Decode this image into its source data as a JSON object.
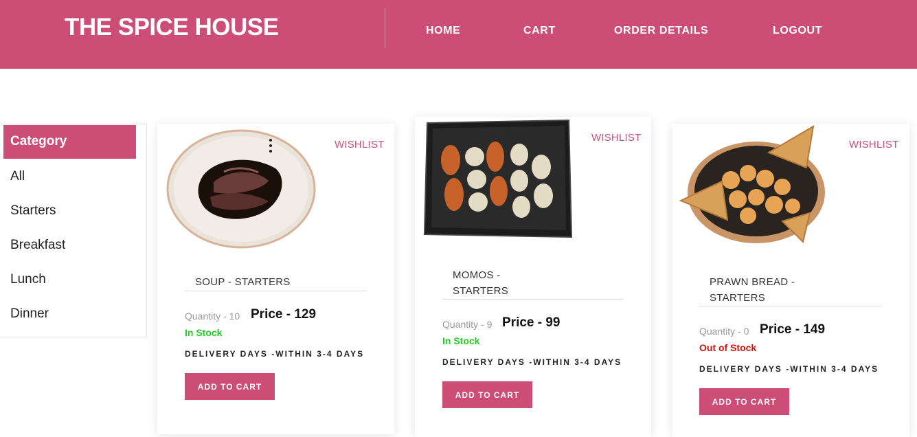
{
  "header": {
    "brand": "THE SPICE HOUSE",
    "nav": [
      "HOME",
      "CART",
      "ORDER DETAILS",
      "LOGOUT"
    ]
  },
  "sidebar": {
    "heading": "Category",
    "items": [
      "All",
      "Starters",
      "Breakfast",
      "Lunch",
      "Dinner"
    ]
  },
  "products": [
    {
      "name_line1": "SOUP - STARTERS",
      "name_line2": "",
      "quantity": "Quantity - 10",
      "price": "Price - 129",
      "stock": "In Stock",
      "stock_color": "#22cc22",
      "delivery": "DELIVERY DAYS -WITHIN 3-4 DAYS",
      "wishlist": "WISHLIST",
      "button": "ADD TO CART"
    },
    {
      "name_line1": "MOMOS -",
      "name_line2": "STARTERS",
      "quantity": "Quantity - 9",
      "price": "Price - 99",
      "stock": "In Stock",
      "stock_color": "#22cc22",
      "delivery": "DELIVERY DAYS -WITHIN 3-4 DAYS",
      "wishlist": "WISHLIST",
      "button": "ADD TO CART"
    },
    {
      "name_line1": "PRAWN BREAD -",
      "name_line2": "STARTERS",
      "quantity": "Quantity - 0",
      "price": "Price - 149",
      "stock": "Out of Stock",
      "stock_color": "#cc1111",
      "delivery": "DELIVERY DAYS -WITHIN 3-4 DAYS",
      "wishlist": "WISHLIST",
      "button": "ADD TO CART"
    }
  ],
  "colors": {
    "brand": "#cc4e77",
    "in_stock": "#22cc22",
    "out_of_stock": "#cc1111"
  }
}
